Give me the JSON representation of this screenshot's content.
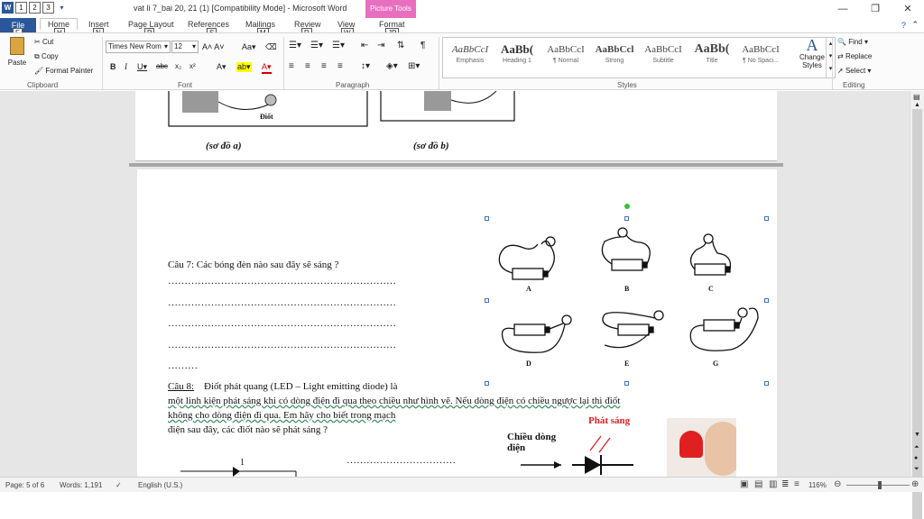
{
  "titlebar": {
    "doc_title": "vat li 7_bai 20, 21 (1) [Compatibility Mode] - Microsoft Word",
    "context_tab": "Picture Tools",
    "qat_badges": [
      "1",
      "2",
      "3"
    ]
  },
  "tabs": [
    {
      "label": "File",
      "key": "F"
    },
    {
      "label": "Home",
      "key": "H"
    },
    {
      "label": "Insert",
      "key": "N"
    },
    {
      "label": "Page Layout",
      "key": "P"
    },
    {
      "label": "References",
      "key": "S"
    },
    {
      "label": "Mailings",
      "key": "M"
    },
    {
      "label": "Review",
      "key": "R"
    },
    {
      "label": "View",
      "key": "W"
    },
    {
      "label": "Format",
      "key": "JP"
    }
  ],
  "clipboard": {
    "paste": "Paste",
    "cut": "Cut",
    "copy": "Copy",
    "format_painter": "Format Painter",
    "label": "Clipboard"
  },
  "font": {
    "name": "Times New Rom",
    "size": "12",
    "label": "Font"
  },
  "paragraph": {
    "label": "Paragraph"
  },
  "styles": {
    "items": [
      {
        "sample": "AaBbCcI",
        "name": "Emphasis"
      },
      {
        "sample": "AaBb(",
        "name": "Heading 1"
      },
      {
        "sample": "AaBbCcI",
        "name": "¶ Normal"
      },
      {
        "sample": "AaBbCcl",
        "name": "Strong"
      },
      {
        "sample": "AaBbCcI",
        "name": "Subtitle"
      },
      {
        "sample": "AaBb(",
        "name": "Title"
      },
      {
        "sample": "AaBbCcI",
        "name": "¶ No Spaci..."
      }
    ],
    "change_styles": "Change Styles",
    "label": "Styles"
  },
  "editing": {
    "find": "Find",
    "replace": "Replace",
    "select": "Select",
    "label": "Editing"
  },
  "document": {
    "caption_a": "(sơ đồ a)",
    "caption_b": "(sơ đồ b)",
    "diode_label": "Điốt",
    "q7": "Câu 7: Các bóng đèn nào sau đây sẽ sáng ?",
    "dots_line": "……………………………………………………………",
    "dots_short": "………",
    "q8_head": "Câu 8:",
    "q8_line1": "Điốt phát quang (LED – Light emitting diode) là",
    "q8_line2": "một linh kiện phát sáng khi có dòng điện đi qua theo chiều như hình vẽ. Nếu dòng điện có chiều ngược lại thì điốt",
    "q8_line3": "không cho dòng điện đi qua. Em hãy cho biết trong mạch",
    "q8_line4": "điện sau đây, các điốt nào sẽ phát sáng ?",
    "dots_bottom": "……………………………",
    "circuit_labels": [
      "A",
      "B",
      "C",
      "D",
      "E",
      "G"
    ],
    "led_current_label": "Chiều dòng điện",
    "led_light_label": "Phát sáng",
    "bottom_num": "1"
  },
  "status": {
    "page": "Page: 5 of 6",
    "words": "Words: 1,191",
    "language": "English (U.S.)",
    "zoom": "116%"
  },
  "colors": {
    "accent": "#2b579a",
    "context": "#e86fc0",
    "led_red": "#e02020"
  }
}
